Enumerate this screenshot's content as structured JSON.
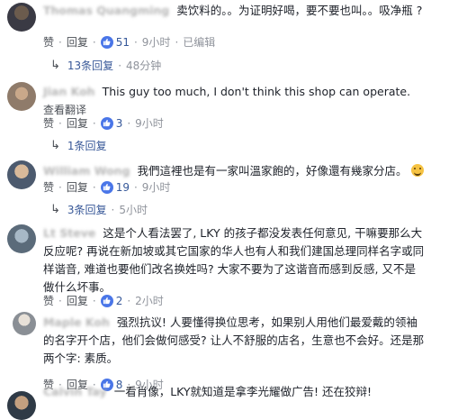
{
  "action_labels": {
    "like": "赞",
    "reply": "回复",
    "edited": "已编辑"
  },
  "comments": [
    {
      "name": "Thomas Quangming",
      "text": "卖饮料的。。为证明好喝，要不要也叫。。吸净瓶 ?",
      "likes": "51",
      "time": "9小时",
      "edited": true,
      "replies": {
        "label": "13条回复",
        "time": "48分钟"
      }
    },
    {
      "name": "Jian Koh",
      "text": "This guy too much, I don't think this shop can operate.",
      "see_translation": "查看翻译",
      "likes": "3",
      "time": "9小时",
      "replies": {
        "label": "1条回复"
      }
    },
    {
      "name": "William Wong",
      "text": "我們這裡也是有一家叫溫家飽的，好像還有幾家分店。",
      "emoji": "smiley",
      "likes": "19",
      "time": "9小时",
      "replies": {
        "label": "3条回复",
        "time": "5小时"
      }
    },
    {
      "name": "Lt Steve",
      "text": "这是个人看法罢了, LKY 的孩子都没发表任何意见, 干嘛要那么大反应呢? 再说在新加坡或其它国家的华人也有人和我们建国总理同样名字或同样谐音, 难道也要他们改名换姓吗? 大家不要为了这谐音而感到反感, 又不是做什么坏事。",
      "likes": "2",
      "time": "2小时"
    },
    {
      "name": "Maple Koh",
      "text": "强烈抗议! 人要懂得换位思考，如果别人用他们最爱戴的领袖的名字开个店，他们会做何感受? 让人不舒服的店名，生意也不会好。还是那两个字: 素质。",
      "likes": "8",
      "time": "9小时"
    },
    {
      "name": "Calvin Tay",
      "text": "一看肖像，LKY就知道是拿李光耀做广告! 还在狡辩!"
    }
  ]
}
